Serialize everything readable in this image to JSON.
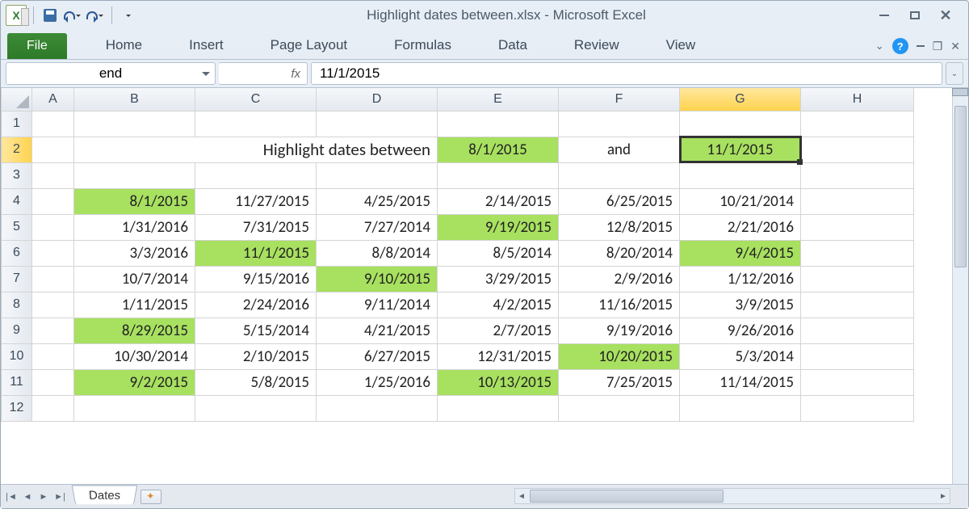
{
  "window_title": "Highlight dates between.xlsx - Microsoft Excel",
  "excel_letter": "X",
  "ribbon": {
    "file": "File",
    "tabs": [
      "Home",
      "Insert",
      "Page Layout",
      "Formulas",
      "Data",
      "Review",
      "View"
    ]
  },
  "name_box": "end",
  "fx_label": "fx",
  "formula_value": "11/1/2015",
  "columns": [
    "A",
    "B",
    "C",
    "D",
    "E",
    "F",
    "G",
    "H"
  ],
  "selected_col": "G",
  "rows": [
    "1",
    "2",
    "3",
    "4",
    "5",
    "6",
    "7",
    "8",
    "9",
    "10",
    "11",
    "12"
  ],
  "selected_row": "2",
  "header_text": "Highlight dates between",
  "and_text": "and",
  "start_date": "8/1/2015",
  "end_date": "11/1/2015",
  "data_grid": [
    [
      {
        "v": "8/1/2015",
        "h": true
      },
      {
        "v": "11/27/2015"
      },
      {
        "v": "4/25/2015"
      },
      {
        "v": "2/14/2015"
      },
      {
        "v": "6/25/2015"
      },
      {
        "v": "10/21/2014"
      }
    ],
    [
      {
        "v": "1/31/2016"
      },
      {
        "v": "7/31/2015"
      },
      {
        "v": "7/27/2014"
      },
      {
        "v": "9/19/2015",
        "h": true
      },
      {
        "v": "12/8/2015"
      },
      {
        "v": "2/21/2016"
      }
    ],
    [
      {
        "v": "3/3/2016"
      },
      {
        "v": "11/1/2015",
        "h": true
      },
      {
        "v": "8/8/2014"
      },
      {
        "v": "8/5/2014"
      },
      {
        "v": "8/20/2014"
      },
      {
        "v": "9/4/2015",
        "h": true
      }
    ],
    [
      {
        "v": "10/7/2014"
      },
      {
        "v": "9/15/2016"
      },
      {
        "v": "9/10/2015",
        "h": true
      },
      {
        "v": "3/29/2015"
      },
      {
        "v": "2/9/2016"
      },
      {
        "v": "1/12/2016"
      }
    ],
    [
      {
        "v": "1/11/2015"
      },
      {
        "v": "2/24/2016"
      },
      {
        "v": "9/11/2014"
      },
      {
        "v": "4/2/2015"
      },
      {
        "v": "11/16/2015"
      },
      {
        "v": "3/9/2015"
      }
    ],
    [
      {
        "v": "8/29/2015",
        "h": true
      },
      {
        "v": "5/15/2014"
      },
      {
        "v": "4/21/2015"
      },
      {
        "v": "2/7/2015"
      },
      {
        "v": "9/19/2016"
      },
      {
        "v": "9/26/2016"
      }
    ],
    [
      {
        "v": "10/30/2014"
      },
      {
        "v": "2/10/2015"
      },
      {
        "v": "6/27/2015"
      },
      {
        "v": "12/31/2015"
      },
      {
        "v": "10/20/2015",
        "h": true
      },
      {
        "v": "5/3/2014"
      }
    ],
    [
      {
        "v": "9/2/2015",
        "h": true
      },
      {
        "v": "5/8/2015"
      },
      {
        "v": "1/25/2016"
      },
      {
        "v": "10/13/2015",
        "h": true
      },
      {
        "v": "7/25/2015"
      },
      {
        "v": "11/14/2015"
      }
    ]
  ],
  "sheet_tab": "Dates",
  "help_char": "?"
}
